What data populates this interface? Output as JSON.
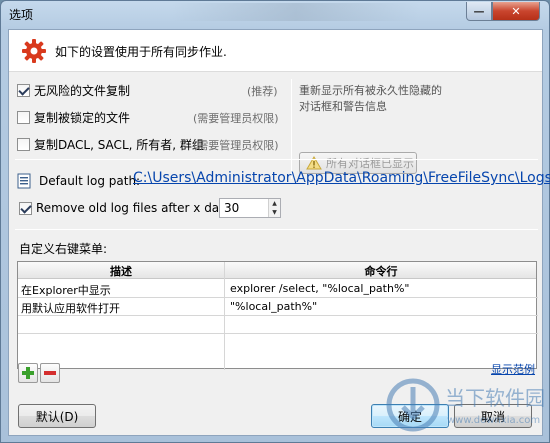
{
  "window": {
    "title": "选项",
    "minimize_label": "—",
    "close_label": "✕"
  },
  "header": {
    "text": "如下的设置使用于所有同步作业."
  },
  "options": [
    {
      "label": "无风险的文件复制",
      "hint": "(推荐)",
      "checked": true
    },
    {
      "label": "复制被锁定的文件",
      "hint": "(需要管理员权限)",
      "checked": false
    },
    {
      "label": "复制DACL, SACL, 所有者, 群组",
      "hint": "(需要管理员权限)",
      "checked": false
    }
  ],
  "restore": {
    "line1": "重新显示所有被永久性隐藏的",
    "line2": "对话框和警告信息",
    "button_label": "所有对话框已显示"
  },
  "log": {
    "label": "Default log path:",
    "path": "C:\\Users\\Administrator\\AppData\\Roaming\\FreeFileSync\\Logs"
  },
  "remove_old": {
    "label": "Remove old log files after x days:",
    "checked": true,
    "value": "30"
  },
  "context_menu": {
    "label": "自定义右键菜单:",
    "columns": [
      "描述",
      "命令行"
    ],
    "rows": [
      {
        "desc": "在Explorer中显示",
        "cmd": "explorer /select, \"%local_path%\""
      },
      {
        "desc": "用默认应用软件打开",
        "cmd": "\"%local_path%\""
      }
    ],
    "show_examples": "显示范例"
  },
  "buttons": {
    "default": "默认(D)",
    "ok": "确定",
    "cancel": "取消"
  },
  "watermark": {
    "text": "当下软件园",
    "sub": "www.downxia.com"
  },
  "colors": {
    "link": "#0645ad",
    "title_bar": "#b4cbe2",
    "close": "#c9452e",
    "plus": "#3aa02c",
    "minus": "#d42e2e"
  }
}
